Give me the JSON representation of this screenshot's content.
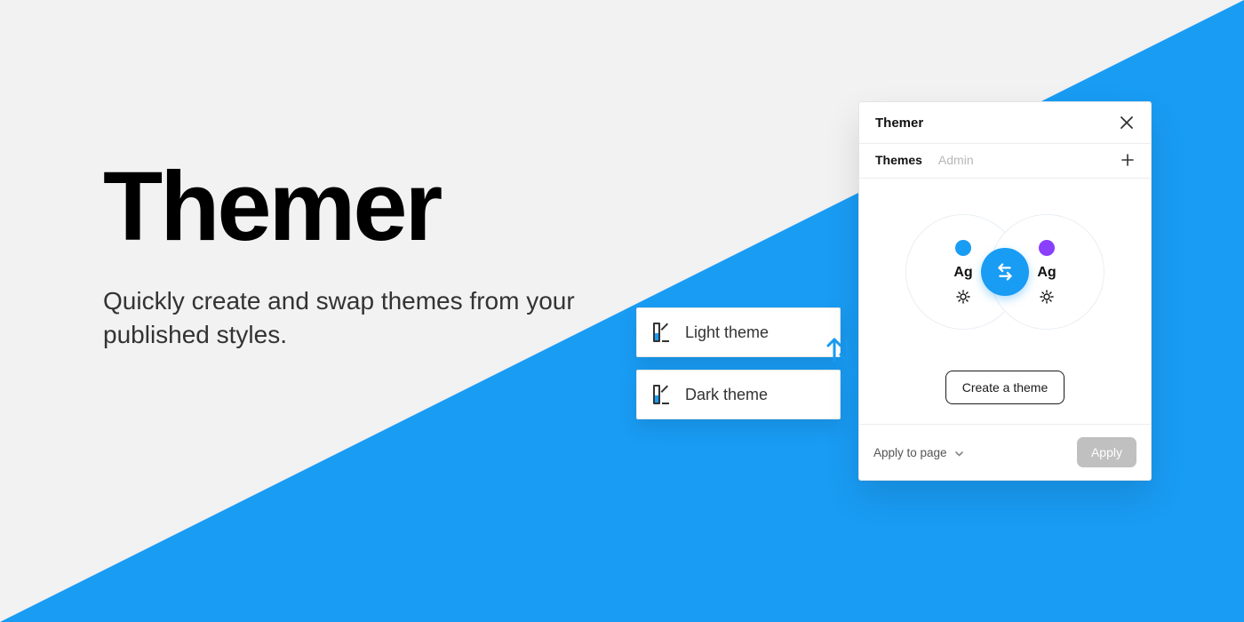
{
  "hero": {
    "title": "Themer",
    "subtitle": "Quickly create and swap themes from your published styles."
  },
  "tiles": {
    "light": "Light theme",
    "dark": "Dark theme"
  },
  "panel": {
    "title": "Themer",
    "tabs": {
      "themes": "Themes",
      "admin": "Admin"
    },
    "preview": {
      "sample_text": "Ag",
      "left_dot_color": "#199cf4",
      "right_dot_color": "#8a3ffc"
    },
    "create_label": "Create a theme",
    "footer": {
      "apply_scope": "Apply to page",
      "apply_button": "Apply"
    }
  },
  "colors": {
    "accent": "#199cf4"
  }
}
